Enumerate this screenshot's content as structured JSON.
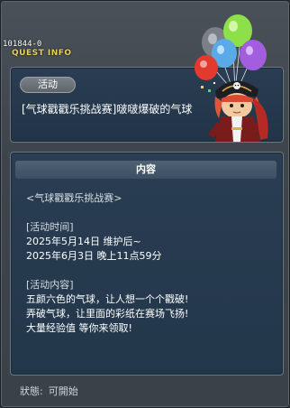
{
  "quest": {
    "id": "101844-0",
    "window_title": "QUEST INFO",
    "category": "活动",
    "name": "[气球戳戳乐挑战赛]啵啵爆破的气球"
  },
  "content": {
    "section_title": "内容",
    "lines": [
      "<气球戳戳乐挑战赛>",
      "",
      "[活动时间]",
      "2025年5月14日  维护后~",
      "2025年6月3日  晚上11点59分",
      "",
      "[活动内容]",
      "五颜六色的气球，让人想一个个戳破!",
      "弄破气球，让里面的彩纸在赛场飞扬!",
      "大量经验值  等你来领取!"
    ]
  },
  "status": {
    "label": "狀態:",
    "value": "可開始"
  },
  "colors": {
    "title_yellow": "#e8d25a",
    "panel_blue": "#23374b"
  },
  "icons": {
    "mascot": "pirate-with-balloons-icon"
  }
}
